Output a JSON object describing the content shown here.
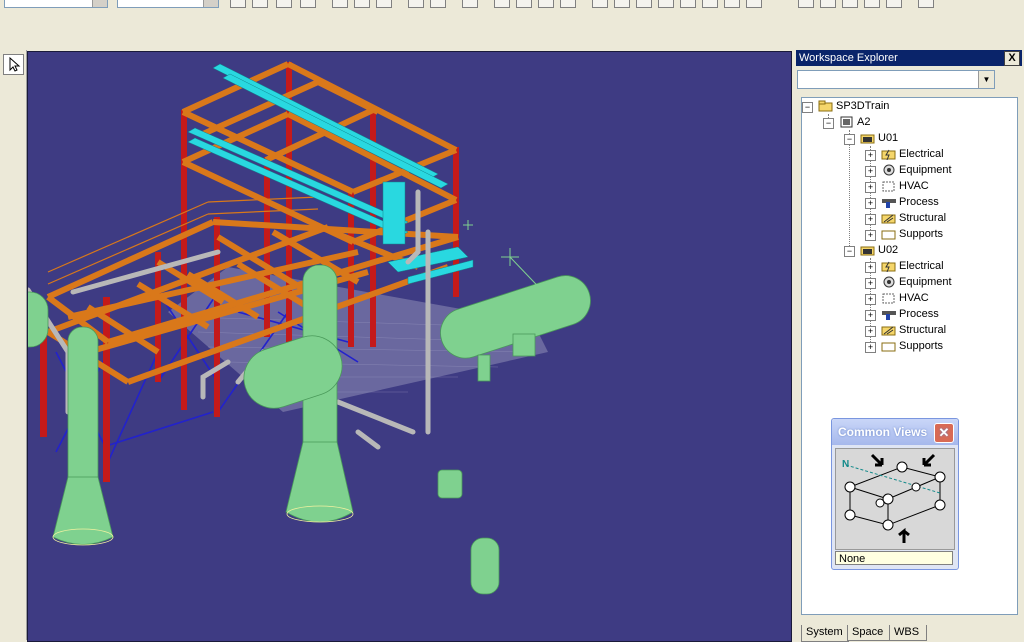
{
  "explorer": {
    "title": "Workspace Explorer",
    "filter_value": "",
    "close_label": "X",
    "tree": {
      "root": "SP3DTrain",
      "area": "A2",
      "units": [
        {
          "name": "U01",
          "children": [
            "Electrical",
            "Equipment",
            "HVAC",
            "Process",
            "Structural",
            "Supports"
          ]
        },
        {
          "name": "U02",
          "children": [
            "Electrical",
            "Equipment",
            "HVAC",
            "Process",
            "Structural",
            "Supports"
          ]
        }
      ]
    },
    "tabs": [
      "System",
      "Space",
      "WBS"
    ]
  },
  "common_views": {
    "title": "Common Views",
    "north_label": "N",
    "status": "None"
  },
  "colors": {
    "viewport_bg": "#3e3b83",
    "steel": "#d9781a",
    "column": "#c41a1a",
    "equipment": "#7fd18f",
    "cable_tray": "#29d8e0",
    "pipe": "#b8b8b8",
    "bracing": "#2222cc",
    "title_bar": "#0a246a"
  }
}
